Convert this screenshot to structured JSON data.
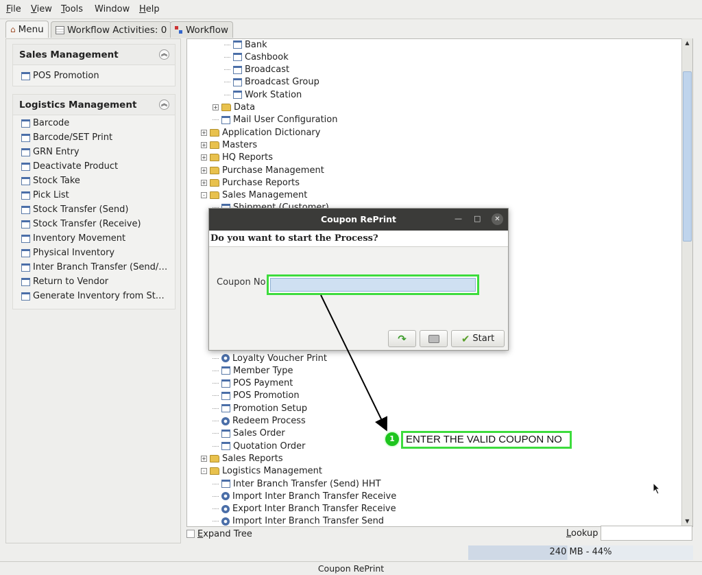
{
  "menubar": {
    "items": [
      {
        "pre": "",
        "u": "F",
        "post": "ile"
      },
      {
        "pre": "",
        "u": "V",
        "post": "iew"
      },
      {
        "pre": "",
        "u": "T",
        "post": "ools"
      },
      {
        "pre": "",
        "u": "",
        "post": "Window"
      },
      {
        "pre": "",
        "u": "H",
        "post": "elp"
      }
    ]
  },
  "tabs": [
    {
      "label": "Menu",
      "icon": "home-icon"
    },
    {
      "label": "Workflow Activities: 0",
      "icon": "table-icon"
    },
    {
      "label": "Workflow",
      "icon": "workflow-icon"
    }
  ],
  "left": {
    "groups": [
      {
        "title": "Sales Management",
        "items": [
          "POS Promotion"
        ]
      },
      {
        "title": "Logistics Management",
        "items": [
          "Barcode",
          "Barcode/SET Print",
          "GRN Entry",
          "Deactivate Product",
          "Stock Take",
          "Pick List",
          "Stock Transfer (Send)",
          "Stock Transfer (Receive)",
          "Inventory Movement",
          "Physical Inventory",
          "Inter Branch Transfer (Send/…",
          "Return to Vendor",
          "Generate Inventory from St…"
        ]
      }
    ]
  },
  "tree": {
    "rows": [
      {
        "label": "Bank",
        "icon": "window",
        "indent": 3,
        "exp": ""
      },
      {
        "label": "Cashbook",
        "icon": "window",
        "indent": 3,
        "exp": ""
      },
      {
        "label": "Broadcast",
        "icon": "window",
        "indent": 3,
        "exp": ""
      },
      {
        "label": "Broadcast Group",
        "icon": "window",
        "indent": 3,
        "exp": ""
      },
      {
        "label": "Work Station",
        "icon": "window",
        "indent": 3,
        "exp": ""
      },
      {
        "label": "Data",
        "icon": "folder",
        "indent": 2,
        "exp": "+"
      },
      {
        "label": "Mail User Configuration",
        "icon": "window",
        "indent": 2,
        "exp": ""
      },
      {
        "label": "Application Dictionary",
        "icon": "folder",
        "indent": 1,
        "exp": "+"
      },
      {
        "label": "Masters",
        "icon": "folder",
        "indent": 1,
        "exp": "+"
      },
      {
        "label": "HQ Reports",
        "icon": "folder",
        "indent": 1,
        "exp": "+"
      },
      {
        "label": "Purchase Management",
        "icon": "folder",
        "indent": 1,
        "exp": "+"
      },
      {
        "label": "Purchase Reports",
        "icon": "folder",
        "indent": 1,
        "exp": "+"
      },
      {
        "label": "Sales Management",
        "icon": "folder",
        "indent": 1,
        "exp": "-"
      },
      {
        "label": "Shipment (Customer)",
        "icon": "window",
        "indent": 2,
        "exp": ""
      }
    ],
    "rows_lower": [
      {
        "label": "Loyalty Voucher Print",
        "icon": "gear",
        "indent": 2,
        "exp": ""
      },
      {
        "label": "Member Type",
        "icon": "window",
        "indent": 2,
        "exp": ""
      },
      {
        "label": "POS Payment",
        "icon": "window",
        "indent": 2,
        "exp": ""
      },
      {
        "label": "POS Promotion",
        "icon": "window",
        "indent": 2,
        "exp": ""
      },
      {
        "label": "Promotion Setup",
        "icon": "window",
        "indent": 2,
        "exp": ""
      },
      {
        "label": "Redeem Process",
        "icon": "gear",
        "indent": 2,
        "exp": ""
      },
      {
        "label": "Sales Order",
        "icon": "window",
        "indent": 2,
        "exp": ""
      },
      {
        "label": "Quotation Order",
        "icon": "window",
        "indent": 2,
        "exp": ""
      },
      {
        "label": "Sales Reports",
        "icon": "folder",
        "indent": 1,
        "exp": "+"
      },
      {
        "label": "Logistics Management",
        "icon": "folder",
        "indent": 1,
        "exp": "-"
      },
      {
        "label": "Inter Branch Transfer (Send) HHT",
        "icon": "window",
        "indent": 2,
        "exp": ""
      },
      {
        "label": "Import Inter Branch Transfer Receive",
        "icon": "gear",
        "indent": 2,
        "exp": ""
      },
      {
        "label": "Export Inter Branch Transfer Receive",
        "icon": "gear",
        "indent": 2,
        "exp": ""
      },
      {
        "label": "Import Inter Branch Transfer Send",
        "icon": "gear",
        "indent": 2,
        "exp": ""
      }
    ]
  },
  "bottom": {
    "expand_tree_pre": "",
    "expand_tree_u": "E",
    "expand_tree_post": "xpand Tree",
    "lookup_u": "L",
    "lookup_post": "ookup",
    "lookup_value": ""
  },
  "status": {
    "memory": "240 MB - 44%",
    "memory_fraction": 0.44,
    "window_name": "Coupon RePrint"
  },
  "dialog": {
    "title": "Coupon RePrint",
    "prompt": "Do you want to start the Process?",
    "field_label": "Coupon No",
    "field_value": "",
    "start_label": "Start"
  },
  "annotation": {
    "step": "1",
    "text": "ENTER THE VALID COUPON NO",
    "color": "#3ddc3d"
  }
}
